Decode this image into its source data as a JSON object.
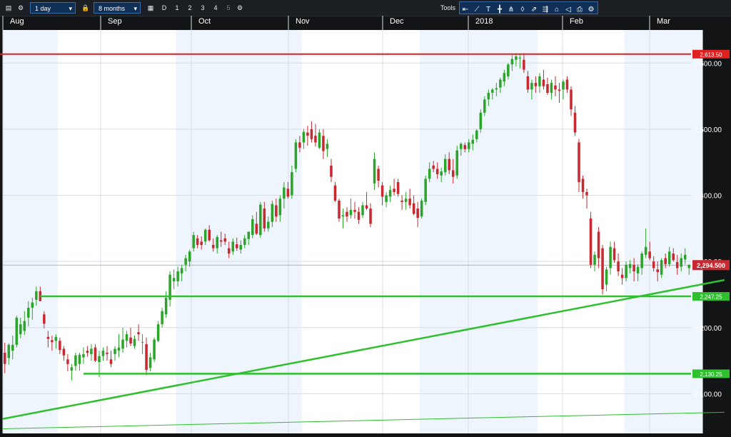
{
  "toolbar": {
    "interval": "1 day",
    "range": "8 months",
    "period_buttons": [
      "D",
      "1",
      "2",
      "3",
      "4",
      "5"
    ],
    "tools_label": "Tools"
  },
  "colors": {
    "background": "#ffffff",
    "shade": "#eef5fc",
    "up": "#2aa52a",
    "down": "#c8282f",
    "resistance": "#e02121",
    "support": "#2fbf2f",
    "trend": "#2fbf2f"
  },
  "chart_data": {
    "type": "candlestick",
    "months": [
      "Aug",
      "Sep",
      "Oct",
      "Nov",
      "Dec",
      "2018",
      "Feb",
      "Mar"
    ],
    "y_ticks": [
      "2,100.00",
      "2,200.00",
      "2,300.00",
      "2,400.00",
      "2,500.00",
      "2,600.00"
    ],
    "ylim": [
      2040,
      2650
    ],
    "grid": true,
    "current_price": "2,294.500",
    "horizontal_levels": [
      {
        "label": "2,613.50",
        "value": 2613.5,
        "color": "#e02121"
      },
      {
        "label": "2,247.25",
        "value": 2247.25,
        "color": "#2fbf2f"
      },
      {
        "label": "2,130.25",
        "value": 2130.25,
        "color": "#2fbf2f"
      }
    ],
    "trendlines": [
      {
        "from": [
          0,
          2062
        ],
        "to": [
          183,
          2272
        ],
        "color": "#2fbf2f",
        "width": 2.5
      },
      {
        "from": [
          0,
          2047
        ],
        "to": [
          183,
          2072
        ],
        "color": "#2fbf2f",
        "width": 1
      }
    ],
    "candles": [
      [
        2162,
        2177,
        2131,
        2145
      ],
      [
        2154,
        2176,
        2144,
        2174
      ],
      [
        2165,
        2188,
        2152,
        2174
      ],
      [
        2174,
        2218,
        2170,
        2215
      ],
      [
        2190,
        2215,
        2184,
        2205
      ],
      [
        2195,
        2225,
        2189,
        2210
      ],
      [
        2215,
        2240,
        2202,
        2230
      ],
      [
        2230,
        2245,
        2212,
        2238
      ],
      [
        2242,
        2262,
        2233,
        2255
      ],
      [
        2255,
        2262,
        2240,
        2240
      ],
      [
        2220,
        2225,
        2199,
        2206
      ],
      [
        2186,
        2195,
        2170,
        2183
      ],
      [
        2181,
        2188,
        2165,
        2178
      ],
      [
        2180,
        2190,
        2168,
        2186
      ],
      [
        2180,
        2185,
        2160,
        2166
      ],
      [
        2168,
        2172,
        2150,
        2158
      ],
      [
        2152,
        2160,
        2134,
        2145
      ],
      [
        2135,
        2145,
        2120,
        2140
      ],
      [
        2142,
        2162,
        2135,
        2158
      ],
      [
        2145,
        2162,
        2135,
        2159
      ],
      [
        2155,
        2170,
        2145,
        2160
      ],
      [
        2165,
        2172,
        2156,
        2162
      ],
      [
        2160,
        2175,
        2150,
        2168
      ],
      [
        2170,
        2175,
        2148,
        2150
      ],
      [
        2148,
        2165,
        2125,
        2157
      ],
      [
        2157,
        2170,
        2150,
        2165
      ],
      [
        2162,
        2172,
        2150,
        2160
      ],
      [
        2152,
        2165,
        2140,
        2145
      ],
      [
        2160,
        2172,
        2150,
        2168
      ],
      [
        2165,
        2190,
        2155,
        2170
      ],
      [
        2168,
        2200,
        2162,
        2182
      ],
      [
        2180,
        2195,
        2170,
        2190
      ],
      [
        2185,
        2200,
        2172,
        2176
      ],
      [
        2172,
        2188,
        2168,
        2183
      ],
      [
        2193,
        2205,
        2180,
        2190
      ],
      [
        2178,
        2190,
        2160,
        2178
      ],
      [
        2175,
        2185,
        2128,
        2136
      ],
      [
        2139,
        2162,
        2134,
        2155
      ],
      [
        2152,
        2185,
        2148,
        2182
      ],
      [
        2180,
        2210,
        2178,
        2205
      ],
      [
        2205,
        2230,
        2200,
        2225
      ],
      [
        2220,
        2255,
        2215,
        2245
      ],
      [
        2242,
        2285,
        2232,
        2280
      ],
      [
        2270,
        2288,
        2258,
        2275
      ],
      [
        2270,
        2292,
        2262,
        2285
      ],
      [
        2282,
        2295,
        2270,
        2290
      ],
      [
        2295,
        2310,
        2285,
        2305
      ],
      [
        2300,
        2318,
        2292,
        2315
      ],
      [
        2320,
        2345,
        2315,
        2340
      ],
      [
        2335,
        2340,
        2320,
        2325
      ],
      [
        2330,
        2338,
        2318,
        2325
      ],
      [
        2330,
        2350,
        2325,
        2348
      ],
      [
        2348,
        2355,
        2330,
        2332
      ],
      [
        2325,
        2335,
        2315,
        2320
      ],
      [
        2320,
        2340,
        2312,
        2337
      ],
      [
        2332,
        2345,
        2322,
        2330
      ],
      [
        2335,
        2342,
        2325,
        2330
      ],
      [
        2320,
        2330,
        2305,
        2312
      ],
      [
        2315,
        2335,
        2310,
        2330
      ],
      [
        2326,
        2336,
        2316,
        2320
      ],
      [
        2318,
        2332,
        2312,
        2325
      ],
      [
        2325,
        2340,
        2320,
        2335
      ],
      [
        2334,
        2345,
        2325,
        2345
      ],
      [
        2340,
        2370,
        2335,
        2364
      ],
      [
        2357,
        2375,
        2340,
        2342
      ],
      [
        2340,
        2390,
        2336,
        2386
      ],
      [
        2380,
        2390,
        2345,
        2350
      ],
      [
        2350,
        2368,
        2345,
        2360
      ],
      [
        2360,
        2392,
        2352,
        2387
      ],
      [
        2385,
        2395,
        2360,
        2368
      ],
      [
        2370,
        2400,
        2360,
        2395
      ],
      [
        2395,
        2420,
        2380,
        2412
      ],
      [
        2410,
        2420,
        2395,
        2398
      ],
      [
        2400,
        2445,
        2395,
        2435
      ],
      [
        2440,
        2485,
        2435,
        2480
      ],
      [
        2480,
        2490,
        2465,
        2472
      ],
      [
        2480,
        2500,
        2470,
        2496
      ],
      [
        2495,
        2505,
        2475,
        2490
      ],
      [
        2500,
        2512,
        2480,
        2485
      ],
      [
        2490,
        2508,
        2474,
        2480
      ],
      [
        2472,
        2500,
        2470,
        2495
      ],
      [
        2490,
        2500,
        2455,
        2467
      ],
      [
        2470,
        2485,
        2458,
        2478
      ],
      [
        2445,
        2455,
        2420,
        2428
      ],
      [
        2415,
        2420,
        2390,
        2392
      ],
      [
        2392,
        2395,
        2360,
        2365
      ],
      [
        2368,
        2380,
        2350,
        2370
      ],
      [
        2375,
        2382,
        2360,
        2368
      ],
      [
        2370,
        2395,
        2365,
        2378
      ],
      [
        2378,
        2390,
        2365,
        2375
      ],
      [
        2375,
        2382,
        2357,
        2363
      ],
      [
        2370,
        2390,
        2366,
        2385
      ],
      [
        2385,
        2405,
        2378,
        2380
      ],
      [
        2380,
        2388,
        2352,
        2357
      ],
      [
        2418,
        2465,
        2408,
        2455
      ],
      [
        2440,
        2445,
        2412,
        2422
      ],
      [
        2415,
        2420,
        2385,
        2398
      ],
      [
        2390,
        2405,
        2382,
        2400
      ],
      [
        2398,
        2415,
        2390,
        2408
      ],
      [
        2410,
        2425,
        2400,
        2405
      ],
      [
        2420,
        2425,
        2398,
        2402
      ],
      [
        2392,
        2400,
        2378,
        2390
      ],
      [
        2390,
        2405,
        2378,
        2395
      ],
      [
        2395,
        2410,
        2380,
        2385
      ],
      [
        2388,
        2400,
        2370,
        2372
      ],
      [
        2380,
        2390,
        2352,
        2366
      ],
      [
        2368,
        2395,
        2365,
        2392
      ],
      [
        2390,
        2430,
        2385,
        2425
      ],
      [
        2425,
        2450,
        2420,
        2440
      ],
      [
        2445,
        2452,
        2435,
        2440
      ],
      [
        2440,
        2450,
        2425,
        2432
      ],
      [
        2430,
        2442,
        2420,
        2436
      ],
      [
        2435,
        2462,
        2430,
        2455
      ],
      [
        2455,
        2465,
        2432,
        2438
      ],
      [
        2438,
        2455,
        2418,
        2428
      ],
      [
        2430,
        2475,
        2425,
        2468
      ],
      [
        2470,
        2480,
        2460,
        2478
      ],
      [
        2476,
        2480,
        2465,
        2470
      ],
      [
        2470,
        2485,
        2465,
        2480
      ],
      [
        2478,
        2492,
        2468,
        2484
      ],
      [
        2485,
        2500,
        2480,
        2498
      ],
      [
        2500,
        2530,
        2495,
        2525
      ],
      [
        2525,
        2550,
        2520,
        2545
      ],
      [
        2545,
        2560,
        2535,
        2555
      ],
      [
        2555,
        2562,
        2545,
        2560
      ],
      [
        2560,
        2570,
        2550,
        2562
      ],
      [
        2563,
        2578,
        2555,
        2575
      ],
      [
        2572,
        2590,
        2565,
        2585
      ],
      [
        2580,
        2600,
        2575,
        2598
      ],
      [
        2598,
        2612,
        2588,
        2606
      ],
      [
        2605,
        2615,
        2595,
        2610
      ],
      [
        2608,
        2614,
        2592,
        2608
      ],
      [
        2605,
        2615,
        2585,
        2590
      ],
      [
        2580,
        2588,
        2555,
        2560
      ],
      [
        2560,
        2575,
        2545,
        2570
      ],
      [
        2570,
        2580,
        2555,
        2565
      ],
      [
        2565,
        2585,
        2555,
        2580
      ],
      [
        2575,
        2590,
        2560,
        2565
      ],
      [
        2568,
        2578,
        2552,
        2555
      ],
      [
        2555,
        2575,
        2545,
        2570
      ],
      [
        2566,
        2580,
        2550,
        2560
      ],
      [
        2560,
        2570,
        2540,
        2558
      ],
      [
        2560,
        2575,
        2545,
        2572
      ],
      [
        2575,
        2580,
        2555,
        2560
      ],
      [
        2560,
        2565,
        2520,
        2530
      ],
      [
        2525,
        2535,
        2490,
        2495
      ],
      [
        2480,
        2485,
        2405,
        2420
      ],
      [
        2425,
        2430,
        2395,
        2405
      ],
      [
        2405,
        2410,
        2380,
        2400
      ],
      [
        2365,
        2375,
        2290,
        2295
      ],
      [
        2295,
        2315,
        2285,
        2310
      ],
      [
        2345,
        2352,
        2290,
        2305
      ],
      [
        2320,
        2325,
        2250,
        2258
      ],
      [
        2265,
        2292,
        2255,
        2288
      ],
      [
        2290,
        2330,
        2280,
        2322
      ],
      [
        2320,
        2330,
        2298,
        2302
      ],
      [
        2300,
        2312,
        2278,
        2285
      ],
      [
        2280,
        2290,
        2265,
        2275
      ],
      [
        2275,
        2300,
        2270,
        2295
      ],
      [
        2290,
        2302,
        2282,
        2296
      ],
      [
        2295,
        2305,
        2270,
        2285
      ],
      [
        2282,
        2296,
        2270,
        2292
      ],
      [
        2290,
        2315,
        2280,
        2312
      ],
      [
        2310,
        2350,
        2305,
        2322
      ],
      [
        2315,
        2330,
        2302,
        2305
      ],
      [
        2300,
        2308,
        2285,
        2290
      ],
      [
        2288,
        2300,
        2270,
        2284
      ],
      [
        2280,
        2305,
        2275,
        2302
      ],
      [
        2305,
        2312,
        2290,
        2296
      ],
      [
        2296,
        2322,
        2292,
        2315
      ],
      [
        2312,
        2320,
        2300,
        2302
      ],
      [
        2299,
        2310,
        2280,
        2290
      ],
      [
        2292,
        2312,
        2285,
        2305
      ],
      [
        2303,
        2320,
        2296,
        2310
      ],
      [
        2290,
        2296,
        2280,
        2294.5
      ]
    ]
  }
}
